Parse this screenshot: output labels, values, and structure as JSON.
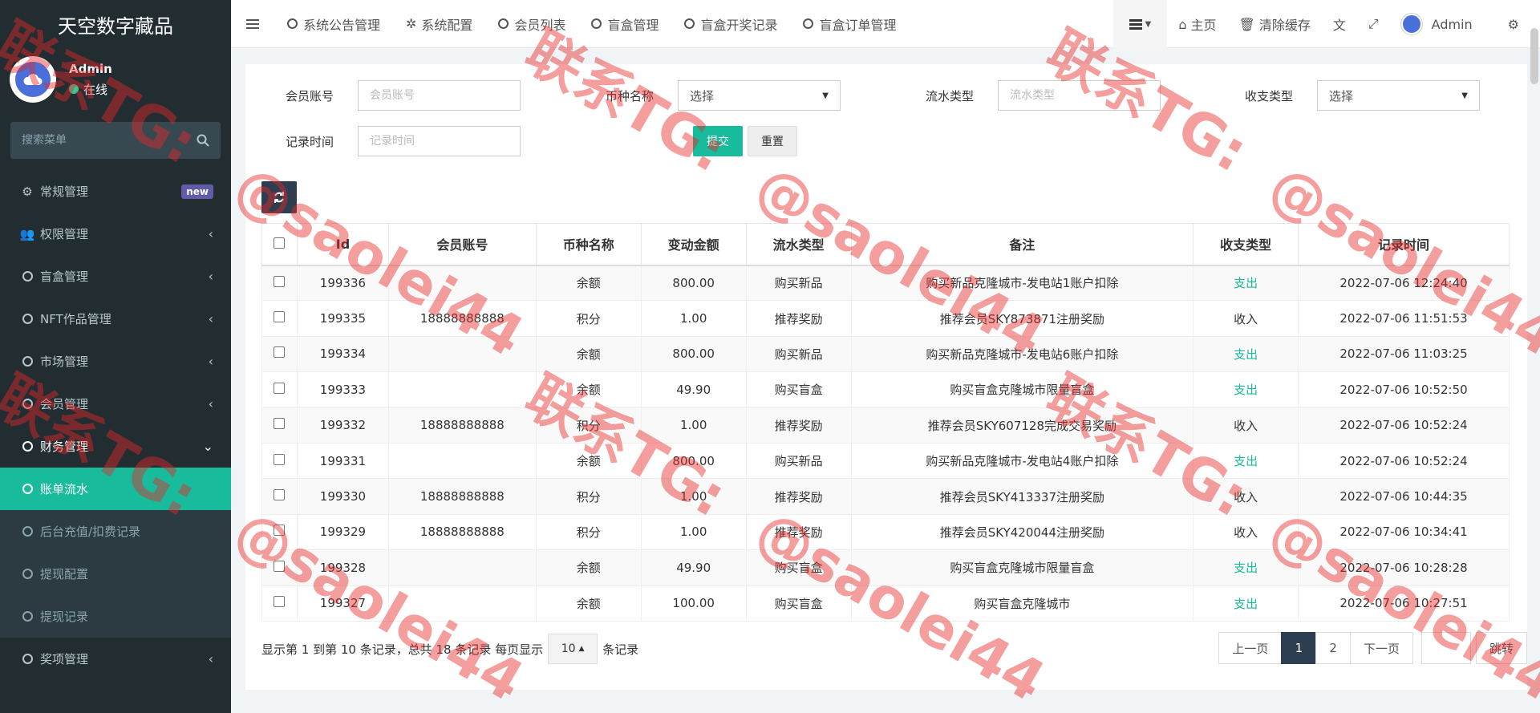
{
  "app": {
    "title": "天空数字藏品"
  },
  "user": {
    "name": "Admin",
    "status": "在线"
  },
  "search": {
    "placeholder": "搜索菜单"
  },
  "sidebar": {
    "items": [
      {
        "label": "常规管理",
        "badge": "new"
      },
      {
        "label": "权限管理"
      },
      {
        "label": "盲盒管理"
      },
      {
        "label": "NFT作品管理"
      },
      {
        "label": "市场管理"
      },
      {
        "label": "会员管理"
      },
      {
        "label": "财务管理"
      },
      {
        "label": "奖项管理"
      }
    ],
    "submenu": [
      {
        "label": "账单流水"
      },
      {
        "label": "后台充值/扣费记录"
      },
      {
        "label": "提现配置"
      },
      {
        "label": "提现记录"
      }
    ]
  },
  "topbar": {
    "tabs": [
      {
        "label": "系统公告管理"
      },
      {
        "label": "系统配置"
      },
      {
        "label": "会员列表"
      },
      {
        "label": "盲盒管理"
      },
      {
        "label": "盲盒开奖记录"
      },
      {
        "label": "盲盒订单管理"
      }
    ],
    "home": "主页",
    "clear_cache": "清除缓存",
    "admin": "Admin"
  },
  "filters": {
    "member_account": {
      "label": "会员账号",
      "placeholder": "会员账号"
    },
    "currency": {
      "label": "币种名称",
      "value": "选择"
    },
    "flow_type": {
      "label": "流水类型",
      "placeholder": "流水类型"
    },
    "io_type": {
      "label": "收支类型",
      "value": "选择"
    },
    "record_time": {
      "label": "记录时间",
      "placeholder": "记录时间"
    },
    "submit": "提交",
    "reset": "重置"
  },
  "table": {
    "headers": [
      "Id",
      "会员账号",
      "币种名称",
      "变动金额",
      "流水类型",
      "备注",
      "收支类型",
      "记录时间"
    ],
    "rows": [
      [
        "199336",
        "",
        "余额",
        "800.00",
        "购买新品",
        "购买新品克隆城市-发电站1账户扣除",
        "支出",
        "2022-07-06 12:24:40"
      ],
      [
        "199335",
        "18888888888",
        "积分",
        "1.00",
        "推荐奖励",
        "推荐会员SKY873871注册奖励",
        "收入",
        "2022-07-06 11:51:53"
      ],
      [
        "199334",
        "",
        "余额",
        "800.00",
        "购买新品",
        "购买新品克隆城市-发电站6账户扣除",
        "支出",
        "2022-07-06 11:03:25"
      ],
      [
        "199333",
        "",
        "余额",
        "49.90",
        "购买盲盒",
        "购买盲盒克隆城市限量盲盒",
        "支出",
        "2022-07-06 10:52:50"
      ],
      [
        "199332",
        "18888888888",
        "积分",
        "1.00",
        "推荐奖励",
        "推荐会员SKY607128完成交易奖励",
        "收入",
        "2022-07-06 10:52:24"
      ],
      [
        "199331",
        "",
        "余额",
        "800.00",
        "购买新品",
        "购买新品克隆城市-发电站4账户扣除",
        "支出",
        "2022-07-06 10:52:24"
      ],
      [
        "199330",
        "18888888888",
        "积分",
        "1.00",
        "推荐奖励",
        "推荐会员SKY413337注册奖励",
        "收入",
        "2022-07-06 10:44:35"
      ],
      [
        "199329",
        "18888888888",
        "积分",
        "1.00",
        "推荐奖励",
        "推荐会员SKY420044注册奖励",
        "收入",
        "2022-07-06 10:34:41"
      ],
      [
        "199328",
        "",
        "余额",
        "49.90",
        "购买盲盒",
        "购买盲盒克隆城市限量盲盒",
        "支出",
        "2022-07-06 10:28:28"
      ],
      [
        "199327",
        "",
        "余额",
        "100.00",
        "购买盲盒",
        "购买盲盒克隆城市",
        "支出",
        "2022-07-06 10:27:51"
      ]
    ]
  },
  "footer": {
    "summary": "显示第 1 到第 10 条记录，总共 18 条记录 每页显示",
    "page_size": "10",
    "suffix": "条记录"
  },
  "pagination": {
    "prev": "上一页",
    "pages": [
      "1",
      "2"
    ],
    "next": "下一页",
    "go": "跳转"
  },
  "watermark": {
    "line1": "联系TG:",
    "line2": "@saolei44"
  },
  "colors": {
    "accent": "#18bc9c",
    "sidebar": "#222d32",
    "dark_button": "#2c3e50",
    "badge": "#605ca8"
  }
}
